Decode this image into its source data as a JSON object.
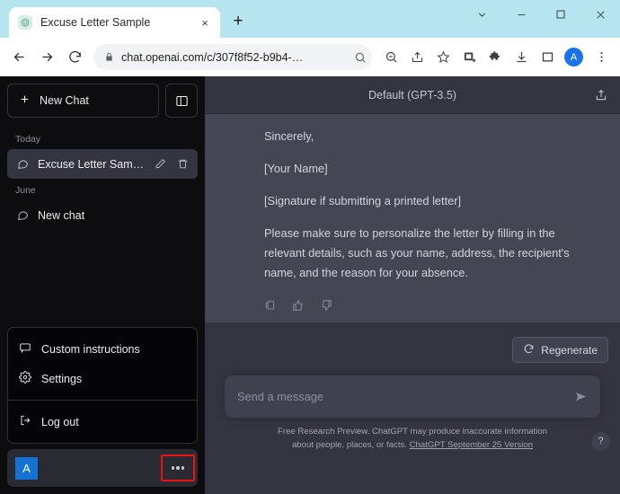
{
  "browser": {
    "tab": {
      "title": "Excuse Letter Sample",
      "favicon": "chatgpt-favicon",
      "close": "×"
    },
    "new_tab_label": "+",
    "window_controls": [
      {
        "name": "chevron-down-icon",
        "glyph": "⌄"
      },
      {
        "name": "minimize-icon",
        "glyph": "—"
      },
      {
        "name": "maximize-icon",
        "glyph": "□"
      },
      {
        "name": "close-icon",
        "glyph": "✕"
      }
    ],
    "nav": {
      "back": "back-arrow-icon",
      "forward": "forward-arrow-icon",
      "reload": "reload-icon"
    },
    "omnibox": {
      "lock": "lock-icon",
      "url": "chat.openai.com/c/307f8f52-b9b4-…",
      "search_icon": "search-icon"
    },
    "toolbar_icons": [
      "zoom-out-icon",
      "share-page-icon",
      "bookmark-star-icon",
      "capture-icon",
      "extensions-puzzle-icon",
      "downloads-icon",
      "side-panel-icon"
    ],
    "profile_initial": "A",
    "menu_icon": "kebab-menu-icon"
  },
  "sidebar": {
    "new_chat_label": "New Chat",
    "new_chat_icon": "plus-icon",
    "panel_toggle_icon": "sidebar-toggle-icon",
    "groups": [
      {
        "label": "Today",
        "items": [
          {
            "label": "Excuse Letter Sample",
            "icon": "chat-bubble-icon",
            "active": true,
            "edit_icon": "pencil-icon",
            "delete_icon": "trash-icon"
          }
        ]
      },
      {
        "label": "June",
        "items": [
          {
            "label": "New chat",
            "icon": "chat-bubble-icon",
            "active": false
          }
        ]
      }
    ],
    "menu": {
      "items": [
        {
          "label": "Custom instructions",
          "icon": "speech-bubble-icon"
        },
        {
          "label": "Settings",
          "icon": "gear-icon"
        },
        {
          "label": "Log out",
          "icon": "logout-icon"
        }
      ]
    },
    "profile": {
      "avatar_initial": "A",
      "more_icon": "ellipsis-icon",
      "highlight_color": "#ee1111"
    }
  },
  "chat": {
    "model": "Default (GPT-3.5)",
    "share_icon": "share-upload-icon",
    "message": {
      "paragraphs": [
        "Sincerely,",
        "[Your Name]",
        "[Signature if submitting a printed letter]",
        "Please make sure to personalize the letter by filling in the relevant details, such as your name, address, the recipient's name, and the reason for your absence."
      ],
      "actions": [
        {
          "name": "copy-icon"
        },
        {
          "name": "thumbs-up-icon"
        },
        {
          "name": "thumbs-down-icon"
        }
      ]
    },
    "regenerate": {
      "label": "Regenerate",
      "icon": "refresh-icon"
    },
    "composer": {
      "placeholder": "Send a message",
      "send_icon": "send-arrow-icon"
    },
    "footer": {
      "text_1": "Free Research Preview. ChatGPT may produce inaccurate information",
      "text_2": "about people, places, or facts. ",
      "link": "ChatGPT September 25 Version",
      "help_label": "?"
    }
  },
  "colors": {
    "titlebar": "#b6e4ef",
    "sidebar": "#0d0d0f",
    "chat_bg": "#343541",
    "assistant_bg": "#444654",
    "accent_blue": "#1472d3",
    "highlight_red": "#ee1111"
  }
}
